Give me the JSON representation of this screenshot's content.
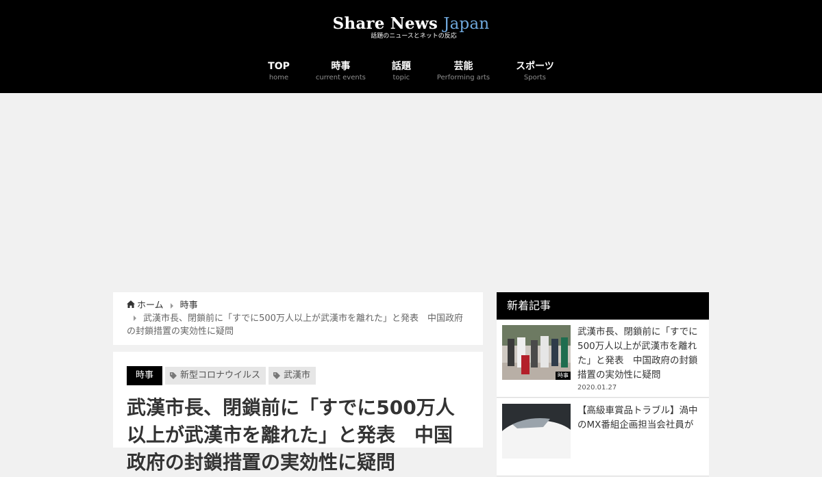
{
  "site": {
    "logo_main": "Share News",
    "logo_accent": "Japan",
    "logo_sub": "話題のニュースとネットの反応"
  },
  "nav": [
    {
      "label": "TOP",
      "sub": "home"
    },
    {
      "label": "時事",
      "sub": "current events"
    },
    {
      "label": "話題",
      "sub": "topic"
    },
    {
      "label": "芸能",
      "sub": "Performing arts"
    },
    {
      "label": "スポーツ",
      "sub": "Sports"
    }
  ],
  "breadcrumb": {
    "home": "ホーム",
    "category": "時事",
    "current": "武漢市長、閉鎖前に「すでに500万人以上が武漢市を離れた」と発表　中国政府の封鎖措置の実効性に疑問"
  },
  "article": {
    "category": "時事",
    "tags": [
      "新型コロナウイルス",
      "武漢市"
    ],
    "title": "武漢市長、閉鎖前に「すでに500万人以上が武漢市を離れた」と発表　中国政府の封鎖措置の実効性に疑問"
  },
  "sidebar": {
    "heading": "新着記事",
    "items": [
      {
        "title": "武漢市長、閉鎖前に「すでに500万人以上が武漢市を離れた」と発表　中国政府の封鎖措置の実効性に疑問",
        "date": "2020.01.27",
        "badge": "時事"
      },
      {
        "title": "【高級車賞品トラブル】渦中のMX番組企画担当会社員が",
        "date": "",
        "badge": ""
      }
    ]
  },
  "colors": {
    "header_bg": "#000000",
    "accent": "#6fa8dc",
    "page_bg": "#f1f1f1"
  }
}
